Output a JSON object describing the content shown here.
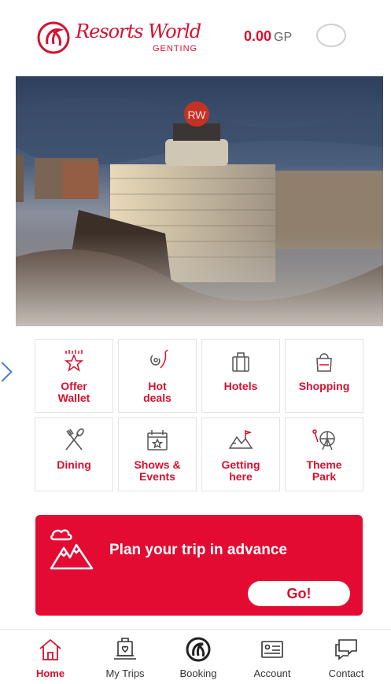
{
  "header": {
    "logo_text": "Resorts World",
    "logo_sub": "GENTING",
    "points_value": "0.00",
    "points_unit": "GP"
  },
  "categories": [
    {
      "label": "Offer\nWallet",
      "icon": "offer-wallet-star-icon"
    },
    {
      "label": "Hot\ndeals",
      "icon": "chili-pepper-icon"
    },
    {
      "label": "Hotels",
      "icon": "luggage-icon"
    },
    {
      "label": "Shopping",
      "icon": "shopping-bag-icon"
    },
    {
      "label": "Dining",
      "icon": "fork-spoon-icon"
    },
    {
      "label": "Shows &\nEvents",
      "icon": "calendar-star-icon"
    },
    {
      "label": "Getting\nhere",
      "icon": "mountain-map-icon"
    },
    {
      "label": "Theme\nPark",
      "icon": "ferris-wheel-icon"
    }
  ],
  "plan": {
    "title": "Plan your trip in advance",
    "button": "Go!"
  },
  "nav": {
    "items": [
      {
        "label": "Home",
        "icon": "home-icon",
        "active": true
      },
      {
        "label": "My Trips",
        "icon": "suitcase-heart-icon",
        "active": false
      },
      {
        "label": "Booking",
        "icon": "rw-logo-icon",
        "active": false
      },
      {
        "label": "Account",
        "icon": "id-card-icon",
        "active": false
      },
      {
        "label": "Contact",
        "icon": "chat-bubbles-icon",
        "active": false
      }
    ]
  },
  "colors": {
    "brand_red": "#d6102f",
    "banner_red": "#e30b32"
  }
}
